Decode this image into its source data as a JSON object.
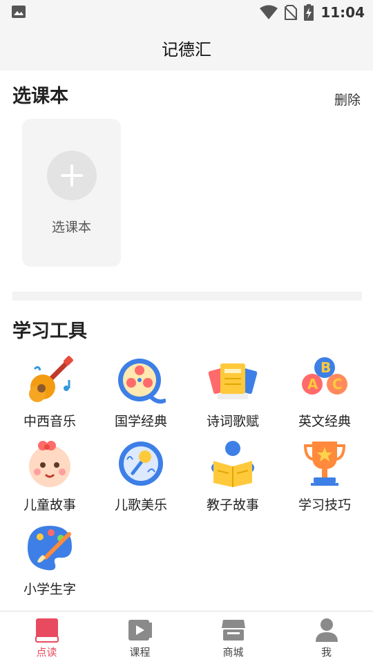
{
  "status_bar": {
    "time": "11:04",
    "icons": [
      "image-icon",
      "wifi-icon",
      "no-sim-icon",
      "battery-charging-icon"
    ]
  },
  "header": {
    "title": "记德汇"
  },
  "textbook_section": {
    "title": "选课本",
    "delete_label": "删除",
    "add_book_label": "选课本"
  },
  "tools_section": {
    "title": "学习工具",
    "items": [
      {
        "label": "中西音乐",
        "icon": "guitar-icon"
      },
      {
        "label": "国学经典",
        "icon": "film-reel-icon"
      },
      {
        "label": "诗词歌赋",
        "icon": "books-icon"
      },
      {
        "label": "英文经典",
        "icon": "abc-balloons-icon"
      },
      {
        "label": "儿童故事",
        "icon": "baby-face-icon"
      },
      {
        "label": "儿歌美乐",
        "icon": "microphone-icon"
      },
      {
        "label": "教子故事",
        "icon": "reading-person-icon"
      },
      {
        "label": "学习技巧",
        "icon": "trophy-icon"
      },
      {
        "label": "小学生字",
        "icon": "paint-palette-icon"
      }
    ]
  },
  "bottom_nav": {
    "active_color": "#e84a5f",
    "items": [
      {
        "label": "点读",
        "icon": "book-icon",
        "active": true
      },
      {
        "label": "课程",
        "icon": "video-icon",
        "active": false
      },
      {
        "label": "商城",
        "icon": "shop-icon",
        "active": false
      },
      {
        "label": "我",
        "icon": "person-icon",
        "active": false
      }
    ]
  }
}
